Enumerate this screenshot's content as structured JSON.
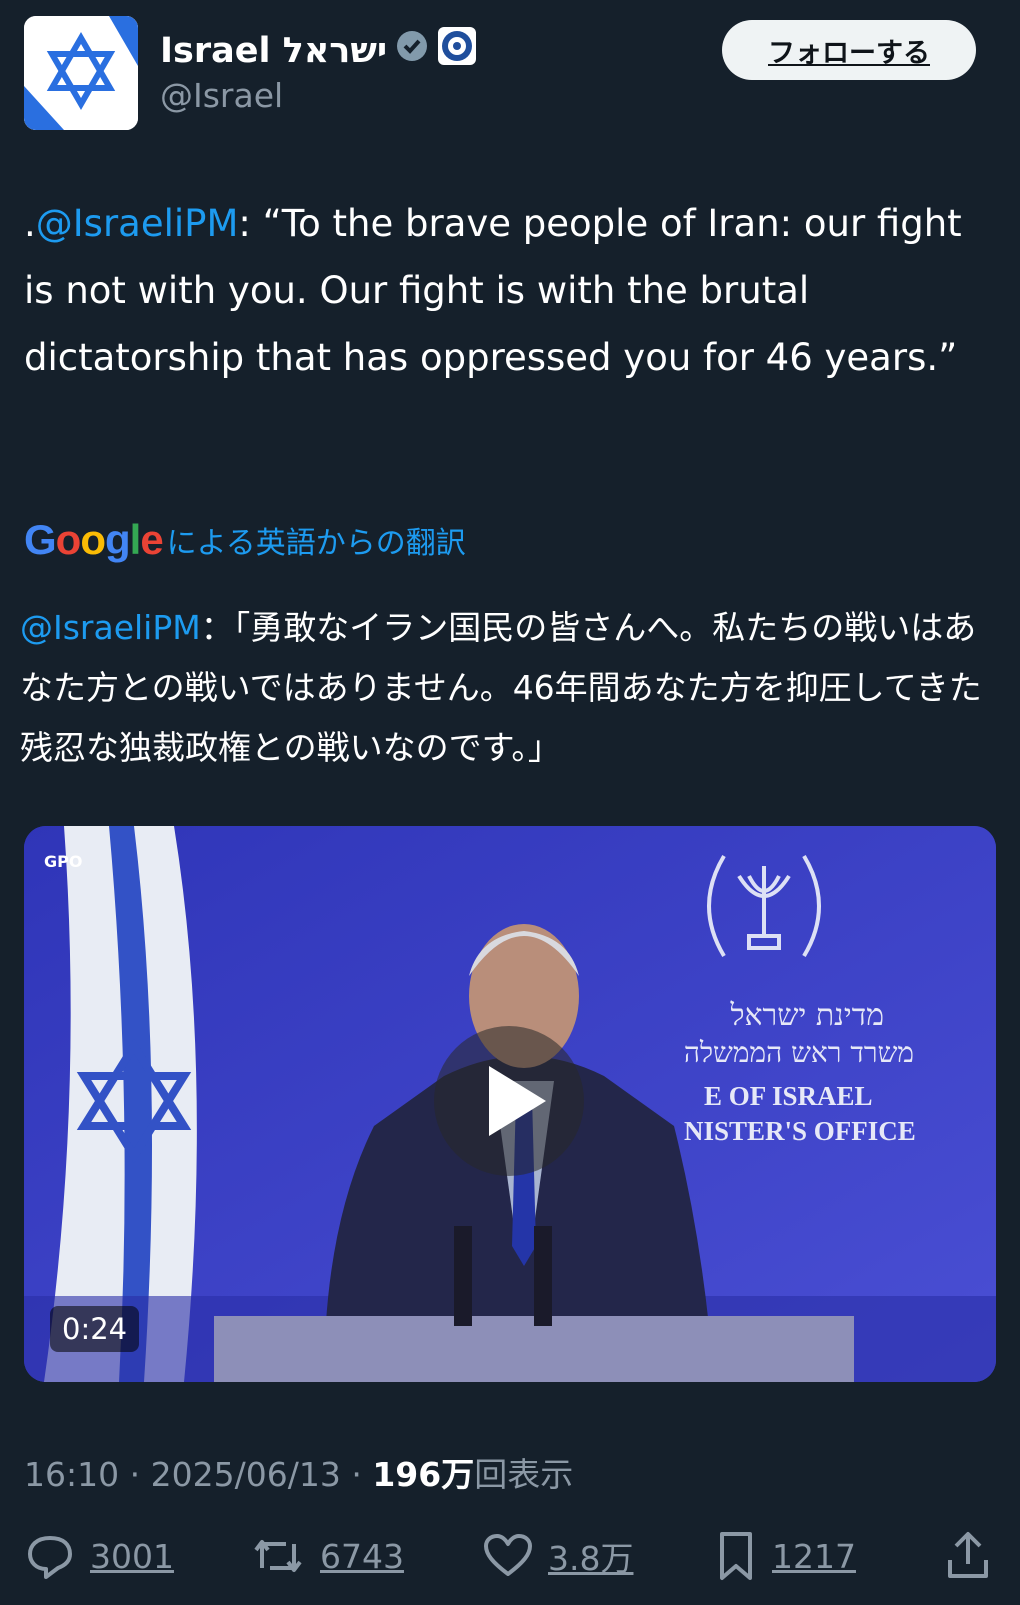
{
  "account": {
    "display_name": "Israel ישראל",
    "handle": "@Israel",
    "follow_label": "フォローする",
    "verified_icon": "verified-badge-icon",
    "affiliate_icon": "affiliate-badge-icon"
  },
  "tweet": {
    "mention_prefix": ".",
    "mention": "@IsraeliPM",
    "text": ": “To the brave people of Iran: our fight is not with you. Our fight is with the brutal dictatorship that has oppressed you for 46 years.”"
  },
  "translation": {
    "google_label": "Google",
    "label": "による英語からの翻訳",
    "mention": "@IsraeliPM",
    "text": "：「勇敢なイラン国民の皆さんへ。私たちの戦いはあなた方との戦いではありません。46年間あなた方を抑圧してきた残忍な独裁政権との戦いなのです。」"
  },
  "media": {
    "duration": "0:24",
    "gpo_label": "GPO",
    "sign_hebrew_1": "מדינת ישראל",
    "sign_hebrew_2": "משרד ראש הממשלה",
    "sign_en_1": "E OF ISRAEL",
    "sign_en_2": "NISTER'S OFFICE",
    "play_icon": "play-icon"
  },
  "meta": {
    "time": "16:10",
    "sep": "·",
    "date": "2025/06/13",
    "views_count": "196万",
    "views_label": "回表示"
  },
  "actions": {
    "replies": "3001",
    "reposts": "6743",
    "likes": "3.8万",
    "bookmarks": "1217"
  },
  "colors": {
    "background": "#15202b",
    "accent": "#1d9bf0",
    "secondary_text": "#8b98a5"
  }
}
